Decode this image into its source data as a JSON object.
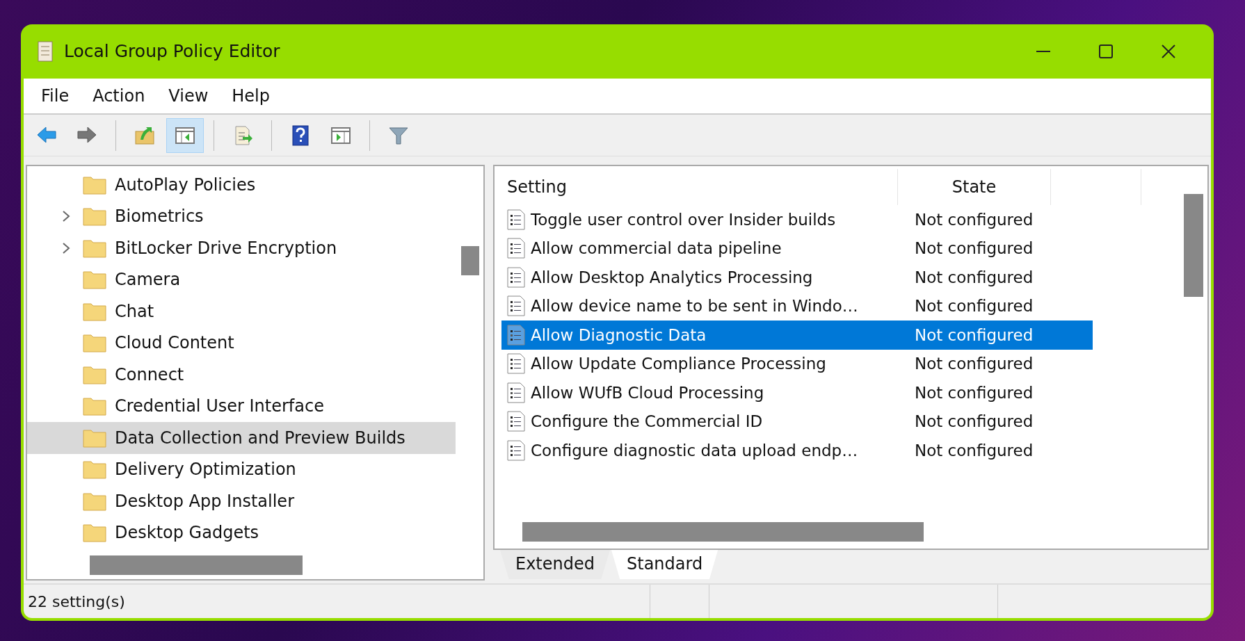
{
  "window": {
    "title": "Local Group Policy Editor"
  },
  "menu": [
    "File",
    "Action",
    "View",
    "Help"
  ],
  "toolbar": [
    {
      "kind": "back",
      "pressed": false
    },
    {
      "kind": "forward",
      "pressed": false
    },
    {
      "kind": "sep"
    },
    {
      "kind": "up",
      "pressed": false
    },
    {
      "kind": "tree",
      "pressed": true
    },
    {
      "kind": "sep"
    },
    {
      "kind": "export",
      "pressed": false
    },
    {
      "kind": "sep"
    },
    {
      "kind": "help",
      "pressed": false
    },
    {
      "kind": "pane",
      "pressed": false
    },
    {
      "kind": "sep"
    },
    {
      "kind": "filter",
      "pressed": false
    }
  ],
  "tree": [
    {
      "label": "AutoPlay Policies",
      "expandable": false,
      "selected": false
    },
    {
      "label": "Biometrics",
      "expandable": true,
      "selected": false
    },
    {
      "label": "BitLocker Drive Encryption",
      "expandable": true,
      "selected": false
    },
    {
      "label": "Camera",
      "expandable": false,
      "selected": false
    },
    {
      "label": "Chat",
      "expandable": false,
      "selected": false
    },
    {
      "label": "Cloud Content",
      "expandable": false,
      "selected": false
    },
    {
      "label": "Connect",
      "expandable": false,
      "selected": false
    },
    {
      "label": "Credential User Interface",
      "expandable": false,
      "selected": false
    },
    {
      "label": "Data Collection and Preview Builds",
      "expandable": false,
      "selected": true
    },
    {
      "label": "Delivery Optimization",
      "expandable": false,
      "selected": false
    },
    {
      "label": "Desktop App Installer",
      "expandable": false,
      "selected": false
    },
    {
      "label": "Desktop Gadgets",
      "expandable": false,
      "selected": false
    }
  ],
  "table": {
    "columns": [
      "Setting",
      "State"
    ],
    "rows": [
      {
        "setting": "Toggle user control over Insider builds",
        "state": "Not configured",
        "selected": false
      },
      {
        "setting": "Allow commercial data pipeline",
        "state": "Not configured",
        "selected": false
      },
      {
        "setting": "Allow Desktop Analytics Processing",
        "state": "Not configured",
        "selected": false
      },
      {
        "setting": "Allow device name to be sent in Windo…",
        "state": "Not configured",
        "selected": false
      },
      {
        "setting": "Allow Diagnostic Data",
        "state": "Not configured",
        "selected": true
      },
      {
        "setting": "Allow Update Compliance Processing",
        "state": "Not configured",
        "selected": false
      },
      {
        "setting": "Allow WUfB Cloud Processing",
        "state": "Not configured",
        "selected": false
      },
      {
        "setting": "Configure the Commercial ID",
        "state": "Not configured",
        "selected": false
      },
      {
        "setting": "Configure diagnostic data upload endp…",
        "state": "Not configured",
        "selected": false
      }
    ]
  },
  "tabs": [
    {
      "label": "Extended",
      "selected": false
    },
    {
      "label": "Standard",
      "selected": true
    }
  ],
  "status_bar": "22 setting(s)"
}
